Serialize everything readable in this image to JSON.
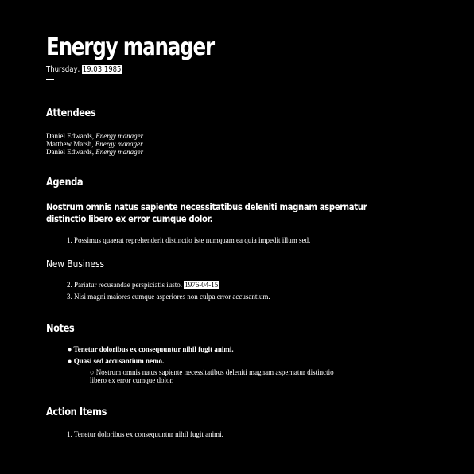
{
  "header": {
    "title": "Energy manager",
    "weekday": "Thursday, ",
    "date": "19,03,1985"
  },
  "attendees": {
    "heading": "Attendees",
    "people": [
      {
        "name": "Daniel Edwards, ",
        "role": "Energy manager"
      },
      {
        "name": "Matthew Marsh, ",
        "role": "Energy manager"
      },
      {
        "name": "Daniel Edwards, ",
        "role": "Energy manager"
      }
    ]
  },
  "agenda": {
    "heading": "Agenda",
    "lead_line1": "Nostrum omnis natus sapiente necessitatibus deleniti magnam aspernatur",
    "lead_line2": "distinctio libero ex error cumque dolor.",
    "items": [
      {
        "number": "1.",
        "text": "Possimus quaerat reprehenderit distinctio iste numquam ea quia impedit illum sed."
      }
    ]
  },
  "new_business": {
    "heading": "New Business",
    "items": [
      {
        "number": "2.",
        "text": "Pariatur recusandae perspiciatis iusto. ",
        "badge": "1976-04-15"
      },
      {
        "number": "3.",
        "text": "Nisi magni maiores cumque asperiores non culpa error accusantium."
      }
    ]
  },
  "notes": {
    "heading": "Notes",
    "items": [
      {
        "bullet": "●",
        "text": "Tenetur doloribus ex consequuntur nihil fugit animi."
      },
      {
        "bullet": "●",
        "text": "Quasi sed accusantium nemo."
      }
    ],
    "subitem": {
      "bullet": "○",
      "line1": "Nostrum omnis natus sapiente necessitatibus deleniti magnam aspernatur distinctio",
      "line2": "libero ex error cumque dolor."
    }
  },
  "action_items": {
    "heading": "Action Items",
    "items": [
      {
        "number": "1.",
        "text": "Tenetur doloribus ex consequuntur nihil fugit animi."
      }
    ]
  }
}
